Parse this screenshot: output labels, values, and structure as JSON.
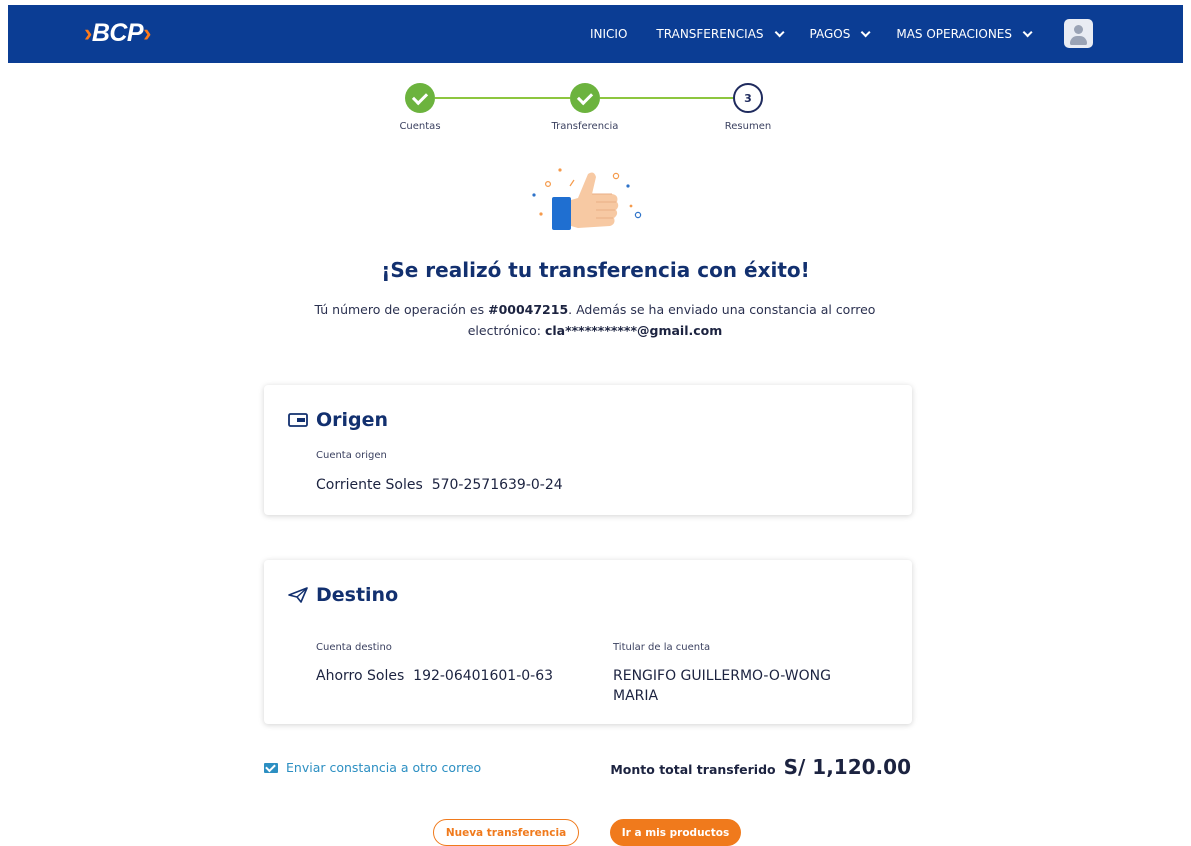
{
  "header": {
    "logo_text": "BCP",
    "nav": [
      {
        "label": "INICIO",
        "dropdown": false
      },
      {
        "label": "TRANSFERENCIAS",
        "dropdown": true
      },
      {
        "label": "PAGOS",
        "dropdown": true
      },
      {
        "label": "MAS OPERACIONES",
        "dropdown": true
      }
    ],
    "avatar_icon": "user-icon"
  },
  "stepper": {
    "steps": [
      {
        "label": "Cuentas",
        "status": "done"
      },
      {
        "label": "Transferencia",
        "status": "done"
      },
      {
        "label": "Resumen",
        "status": "current",
        "number": "3"
      }
    ]
  },
  "success": {
    "illustration": "thumbs-up-icon",
    "title": "¡Se realizó tu transferencia con éxito!",
    "message_prefix": "Tú número de operación es ",
    "operation_number": "#00047215",
    "message_middle": ". Además se ha enviado una constancia al correo electrónico: ",
    "email": "cla***********@gmail.com"
  },
  "origin": {
    "title": "Origen",
    "icon": "card-icon",
    "account_label": "Cuenta origen",
    "account_type": "Corriente Soles",
    "account_number": "570-2571639-0-24"
  },
  "destination": {
    "title": "Destino",
    "icon": "paper-plane-icon",
    "account_label": "Cuenta destino",
    "account_type": "Ahorro Soles",
    "account_number": "192-06401601-0-63",
    "holder_label": "Titular de la cuenta",
    "holder_name_line1": "RENGIFO GUILLERMO-O-WONG",
    "holder_name_line2": "MARIA"
  },
  "footer": {
    "send_link": "Enviar constancia a otro correo",
    "total_label": "Monto total transferido",
    "total_amount": "S/ 1,120.00",
    "new_transfer_button": "Nueva transferencia",
    "products_button": "Ir a mis productos"
  },
  "colors": {
    "navbar": "#0b3d94",
    "accent_orange": "#f07a1c",
    "success_green": "#6cb33e",
    "title_blue": "#12306f",
    "link_blue": "#2c8fc2"
  }
}
